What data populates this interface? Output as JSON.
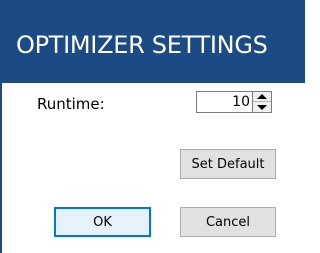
{
  "dialog": {
    "title": "OPTIMIZER SETTINGS"
  },
  "runtime": {
    "label": "Runtime:",
    "value": "10"
  },
  "buttons": {
    "set_default": "Set Default",
    "ok": "OK",
    "cancel": "Cancel"
  },
  "icons": {
    "spin_up": "triangle-up-icon",
    "spin_down": "triangle-down-icon"
  },
  "colors": {
    "title_bar": "#1c4a84",
    "title_text": "#ffffff",
    "focus_accent": "#0078d7"
  }
}
